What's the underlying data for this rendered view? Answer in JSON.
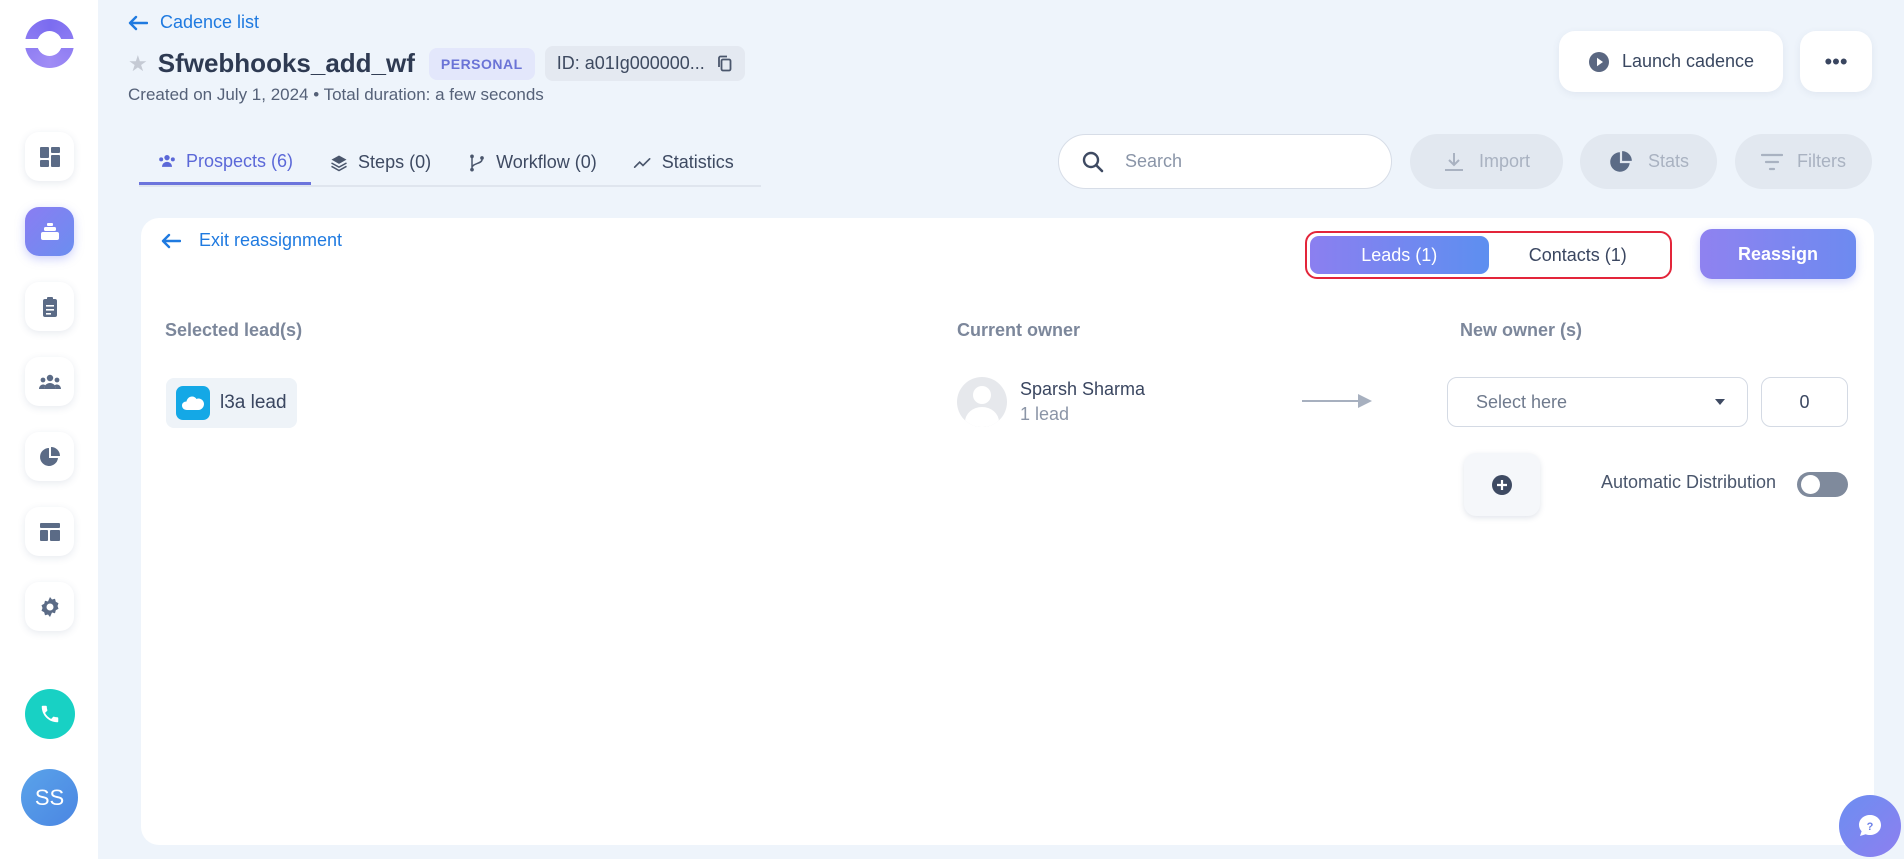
{
  "header": {
    "back_label": "Cadence list",
    "title": "Sfwebhooks_add_wf",
    "badge": "PERSONAL",
    "id_label": "ID: a01Ig000000...",
    "subtitle": "Created on July 1, 2024 • Total duration: a few seconds",
    "launch_label": "Launch cadence",
    "more_label": "•••"
  },
  "sidebar": {
    "items": [
      {
        "icon": "dashboard-icon"
      },
      {
        "icon": "cadence-icon",
        "active": true
      },
      {
        "icon": "tasks-icon"
      },
      {
        "icon": "people-icon"
      },
      {
        "icon": "pie-chart-icon"
      },
      {
        "icon": "templates-icon"
      },
      {
        "icon": "gear-icon"
      }
    ],
    "avatar_initials": "SS"
  },
  "tabs": [
    {
      "label": "Prospects (6)",
      "icon": "people-icon",
      "active": true
    },
    {
      "label": "Steps (0)",
      "icon": "layers-icon"
    },
    {
      "label": "Workflow (0)",
      "icon": "branch-icon"
    },
    {
      "label": "Statistics",
      "icon": "trend-icon"
    }
  ],
  "toolbar": {
    "search_placeholder": "Search",
    "import_label": "Import",
    "stats_label": "Stats",
    "filters_label": "Filters"
  },
  "reassign": {
    "exit_label": "Exit reassignment",
    "seg_leads": "Leads (1)",
    "seg_contacts": "Contacts (1)",
    "reassign_label": "Reassign",
    "col_selected": "Selected lead(s)",
    "col_current": "Current owner",
    "col_new": "New owner (s)",
    "lead_name": "l3a lead",
    "owner_name": "Sparsh Sharma",
    "owner_count": "1 lead",
    "select_placeholder": "Select here",
    "count_value": "0",
    "auto_dist_label": "Automatic Distribution"
  },
  "colors": {
    "accent": "#6b74dc",
    "link": "#1f7ae0",
    "highlight_border": "#e3253a"
  }
}
